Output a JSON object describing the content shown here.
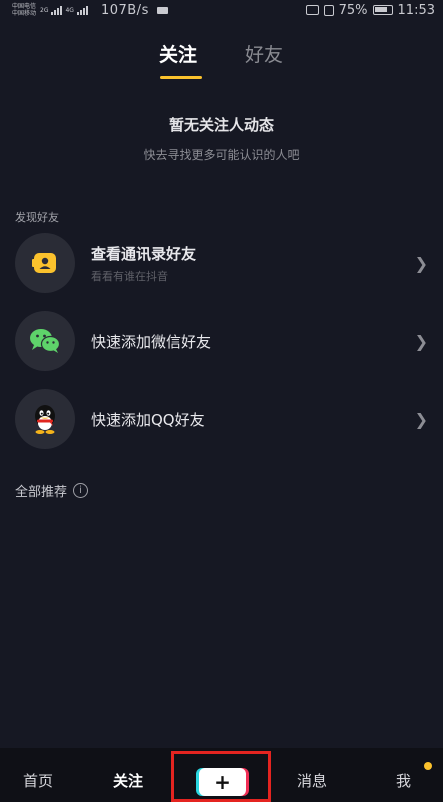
{
  "status_bar": {
    "carrier1": "中国电信",
    "carrier2": "中国移动",
    "sig1_label": "2G",
    "sig2_label": "4G",
    "speed": "107B/s",
    "battery": "75%",
    "time": "11:53"
  },
  "tabs": {
    "follow": "关注",
    "friends": "好友"
  },
  "empty_state": {
    "title": "暂无关注人动态",
    "subtitle": "快去寻找更多可能认识的人吧"
  },
  "discover": {
    "label": "发现好友",
    "items": [
      {
        "title": "查看通讯录好友",
        "subtitle": "看看有谁在抖音",
        "icon": "contacts-icon"
      },
      {
        "title": "快速添加微信好友",
        "icon": "wechat-icon"
      },
      {
        "title": "快速添加QQ好友",
        "icon": "qq-icon"
      }
    ]
  },
  "recommend": {
    "label": "全部推荐"
  },
  "bottom_nav": {
    "home": "首页",
    "follow": "关注",
    "publish": "+",
    "messages": "消息",
    "me": "我"
  },
  "colors": {
    "accent": "#fbc22d",
    "background": "#161823",
    "highlight": "#e42420"
  }
}
